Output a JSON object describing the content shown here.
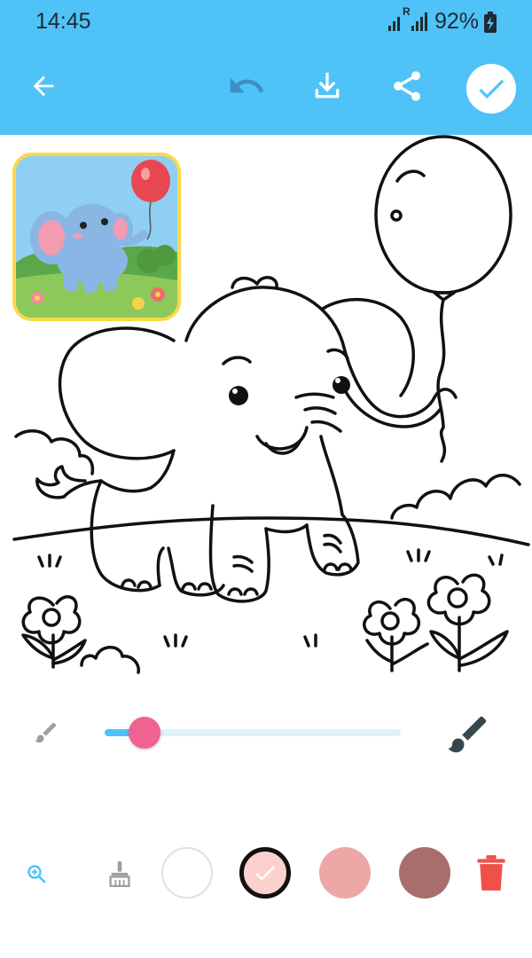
{
  "status": {
    "time": "14:45",
    "signal_icon": "signal-icon",
    "roaming_badge": "R",
    "battery_percent": "92%",
    "battery_icon": "battery-charging-icon"
  },
  "toolbar": {
    "back_icon": "arrow-left-icon",
    "undo_icon": "undo-icon",
    "download_icon": "download-icon",
    "share_icon": "share-icon",
    "done_icon": "check-icon"
  },
  "brush": {
    "size_fraction": 0.08,
    "small_icon": "small-brush-icon",
    "large_icon": "large-brush-icon",
    "thumb_color": "#f06292",
    "track_color": "#dff2fc",
    "fill_color": "#4fc3f7"
  },
  "palette": {
    "zoom_icon": "zoom-in-icon",
    "eraser_icon": "broom-icon",
    "colors": [
      "#ffffff",
      "#fbd1cf",
      "#eda7a6",
      "#a86d6d"
    ],
    "selected_index": 1,
    "delete_icon": "trash-icon",
    "delete_color": "#f0504a"
  },
  "accent": "#4fc3f7"
}
